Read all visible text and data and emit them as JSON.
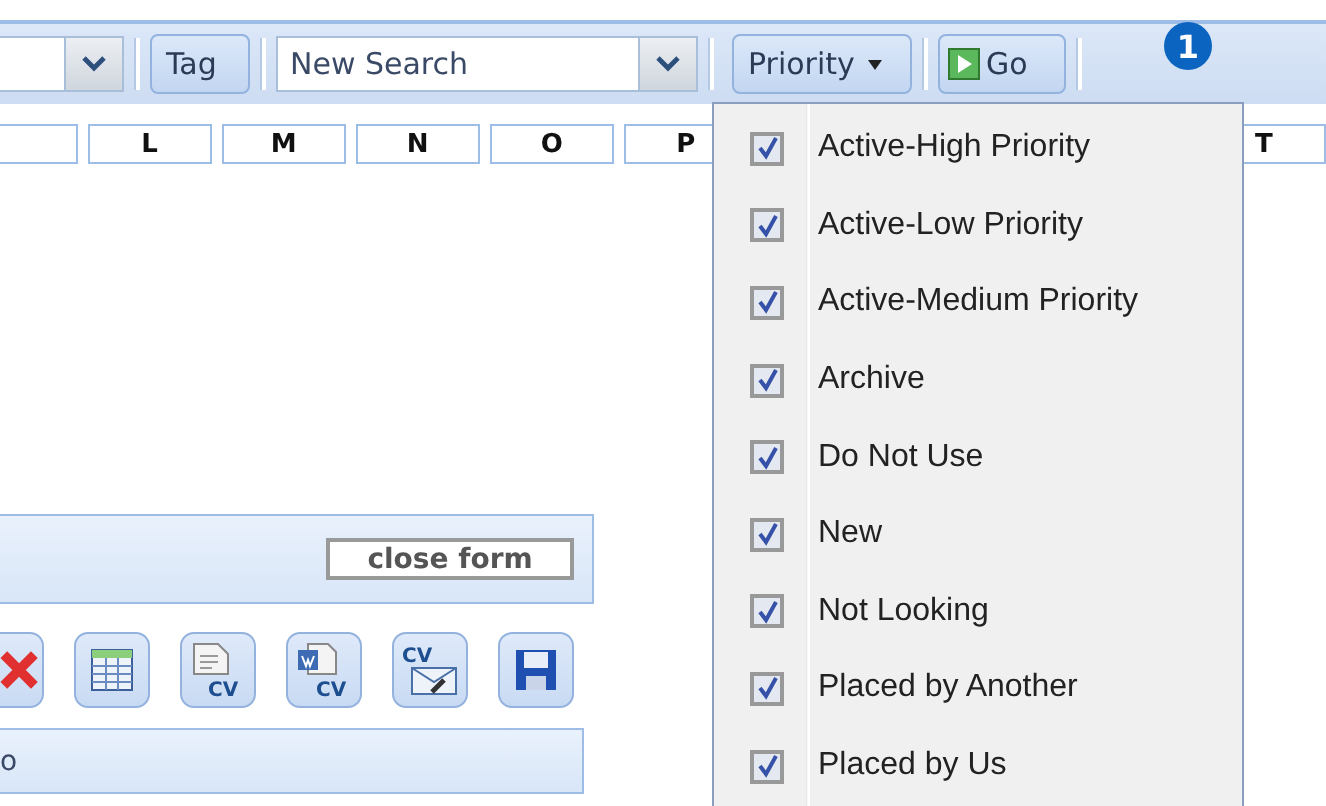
{
  "toolbar": {
    "tag_button": "Tag",
    "search_combo": {
      "value": "New Search"
    },
    "priority_button": "Priority",
    "go_button": "Go",
    "badge": "1"
  },
  "letters": [
    "L",
    "M",
    "N",
    "O",
    "P",
    "T"
  ],
  "priority_menu": [
    {
      "label": "Active-High Priority",
      "checked": true
    },
    {
      "label": "Active-Low Priority",
      "checked": true
    },
    {
      "label": "Active-Medium Priority",
      "checked": true
    },
    {
      "label": "Archive",
      "checked": true
    },
    {
      "label": "Do Not Use",
      "checked": true
    },
    {
      "label": "New",
      "checked": true
    },
    {
      "label": "Not Looking",
      "checked": true
    },
    {
      "label": "Placed by Another",
      "checked": true
    },
    {
      "label": "Placed by Us",
      "checked": true
    }
  ],
  "form": {
    "close_button": "close form"
  },
  "actions": [
    {
      "kind": "delete"
    },
    {
      "kind": "table"
    },
    {
      "kind": "document",
      "label": "CV"
    },
    {
      "kind": "word",
      "label": "CV"
    },
    {
      "kind": "email",
      "label": "CV"
    },
    {
      "kind": "save"
    }
  ],
  "bottom_bar": {
    "text": "o"
  }
}
